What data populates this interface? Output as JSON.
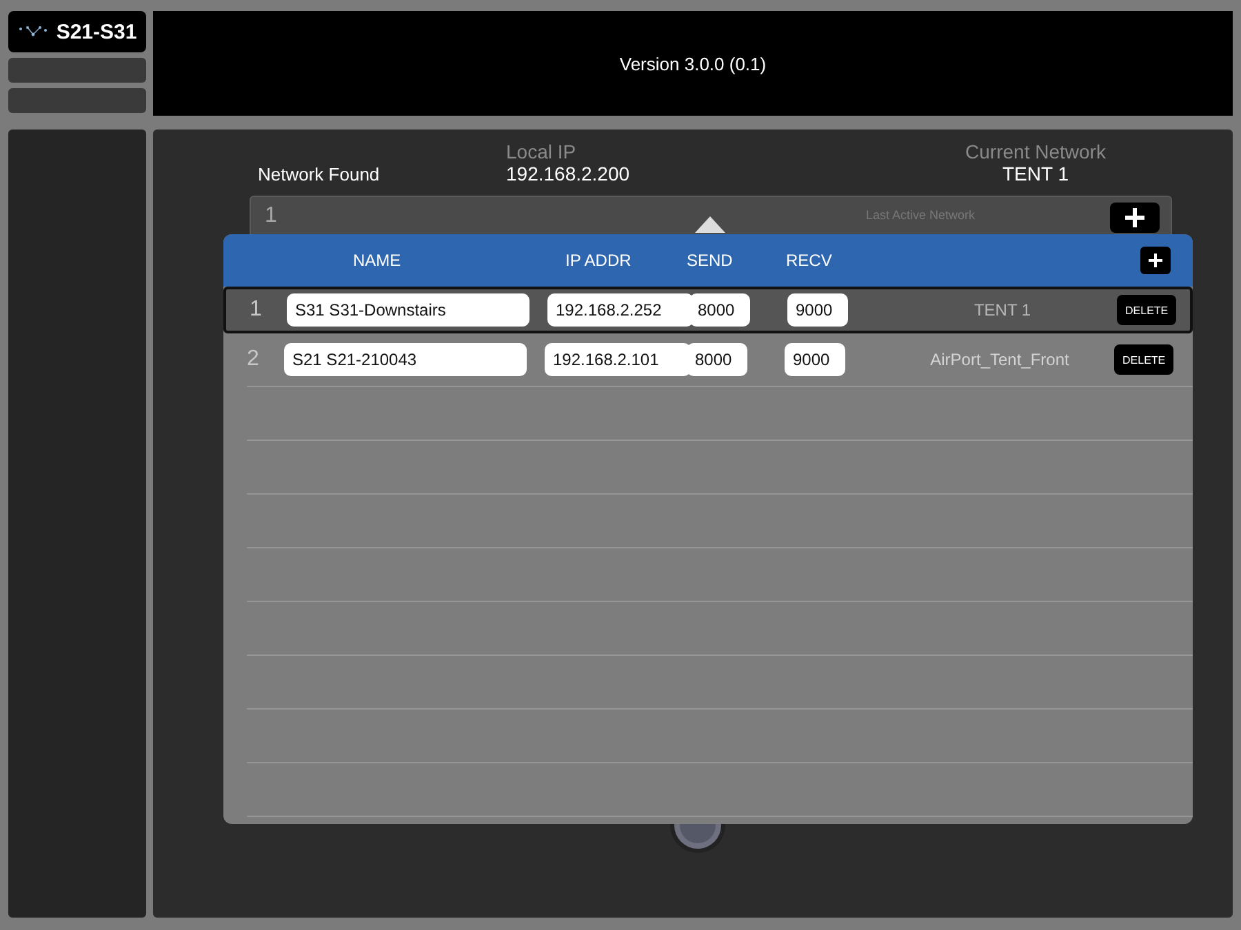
{
  "app": {
    "logo": "S21-S31"
  },
  "header": {
    "version": "Version 3.0.0 (0.1)"
  },
  "status": {
    "label": "Network Found",
    "local_ip_label": "Local IP",
    "local_ip": "192.168.2.200",
    "current_network_label": "Current Network",
    "current_network": "TENT 1"
  },
  "background_card": {
    "index": "1",
    "last_active_label": "Last Active Network"
  },
  "table": {
    "columns": [
      "NAME",
      "IP ADDR",
      "SEND",
      "RECV"
    ],
    "rows": [
      {
        "index": "1",
        "name": "S31 S31-Downstairs",
        "ip": "192.168.2.252",
        "send": "8000",
        "recv": "9000",
        "network": "TENT 1",
        "action": "DELETE",
        "selected": true
      },
      {
        "index": "2",
        "name": "S21 S21-210043",
        "ip": "192.168.2.101",
        "send": "8000",
        "recv": "9000",
        "network": "AirPort_Tent_Front",
        "action": "DELETE",
        "selected": false
      }
    ]
  }
}
